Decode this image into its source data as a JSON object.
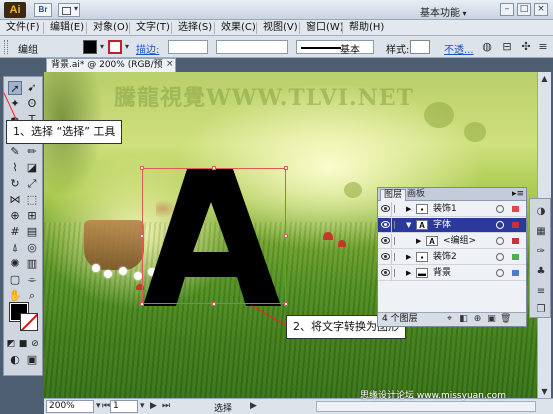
{
  "titlebar": {
    "app_logo": "Ai",
    "bridge_label": "Br",
    "workspace": "基本功能",
    "window_buttons": [
      "–",
      "□",
      "×"
    ]
  },
  "menubar": {
    "items": [
      "文件(F)",
      "编辑(E)",
      "对象(O)",
      "文字(T)",
      "选择(S)",
      "效果(C)",
      "视图(V)",
      "窗口(W)",
      "帮助(H)"
    ]
  },
  "controlbar": {
    "group_label": "编组",
    "stroke_link": "描边:",
    "brush_label": "基本",
    "style_label": "样式:",
    "opacity_link": "不透..."
  },
  "document": {
    "tab_label": "背景.ai* @ 200% (RGB/预览)",
    "tab_close": "×"
  },
  "canvas": {
    "watermark": "騰龍視覺WWW.TLVI.NET",
    "letter": "A"
  },
  "callouts": {
    "step1": "1、选择 “选择” 工具",
    "step2": "2、将文字转换为图形"
  },
  "layers_panel": {
    "tabs": [
      "图层",
      "画板"
    ],
    "menu_icon": "▸≡",
    "rows": [
      {
        "name": "装饰1",
        "thumb": "▪",
        "indent": 0,
        "selected": false,
        "color": "#e54545",
        "expanded": false
      },
      {
        "name": "字体",
        "thumb": "A",
        "indent": 0,
        "selected": true,
        "color": "#c8303a",
        "expanded": true
      },
      {
        "name": "<编组>",
        "thumb": "A",
        "indent": 1,
        "selected": false,
        "color": "#c8303a",
        "expanded": false
      },
      {
        "name": "装饰2",
        "thumb": "▪",
        "indent": 0,
        "selected": false,
        "color": "#4caf50",
        "expanded": false
      },
      {
        "name": "背景",
        "thumb": "▬",
        "indent": 0,
        "selected": false,
        "color": "#4a7bd0",
        "expanded": false
      }
    ],
    "footer": "4 个图层"
  },
  "statusbar": {
    "zoom": "200%",
    "page": "1",
    "status": "选择",
    "credit": "思缘设计论坛 www.missyuan.com"
  },
  "colors": {
    "fill": "#000000",
    "stroke_none_slash": "#dd1111",
    "accent": "#2b3a9a",
    "callout_line": "#ff1a1a"
  }
}
